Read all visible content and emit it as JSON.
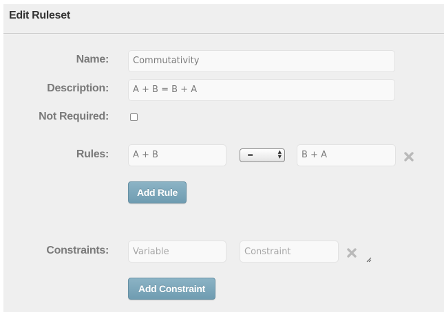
{
  "panel": {
    "title": "Edit Ruleset"
  },
  "form": {
    "name_label": "Name:",
    "name_value": "Commutativity",
    "description_label": "Description:",
    "description_value": "A + B = B + A",
    "not_required_label": "Not Required:",
    "not_required_checked": false,
    "rules_label": "Rules:",
    "rules": [
      {
        "left": "A + B",
        "operator": "=",
        "right": "B + A",
        "remove_icon": "close-x-icon"
      }
    ],
    "add_rule_label": "Add Rule",
    "constraints_label": "Constraints:",
    "constraint_variable_placeholder": "Variable",
    "constraint_value_placeholder": "Constraint",
    "constraint_remove_icon": "close-x-icon",
    "add_constraint_label": "Add Constraint"
  },
  "colors": {
    "panel_bg": "#efefef",
    "button_bg": "#7ca6b9",
    "label": "#7a7a7a",
    "title": "#333333"
  }
}
